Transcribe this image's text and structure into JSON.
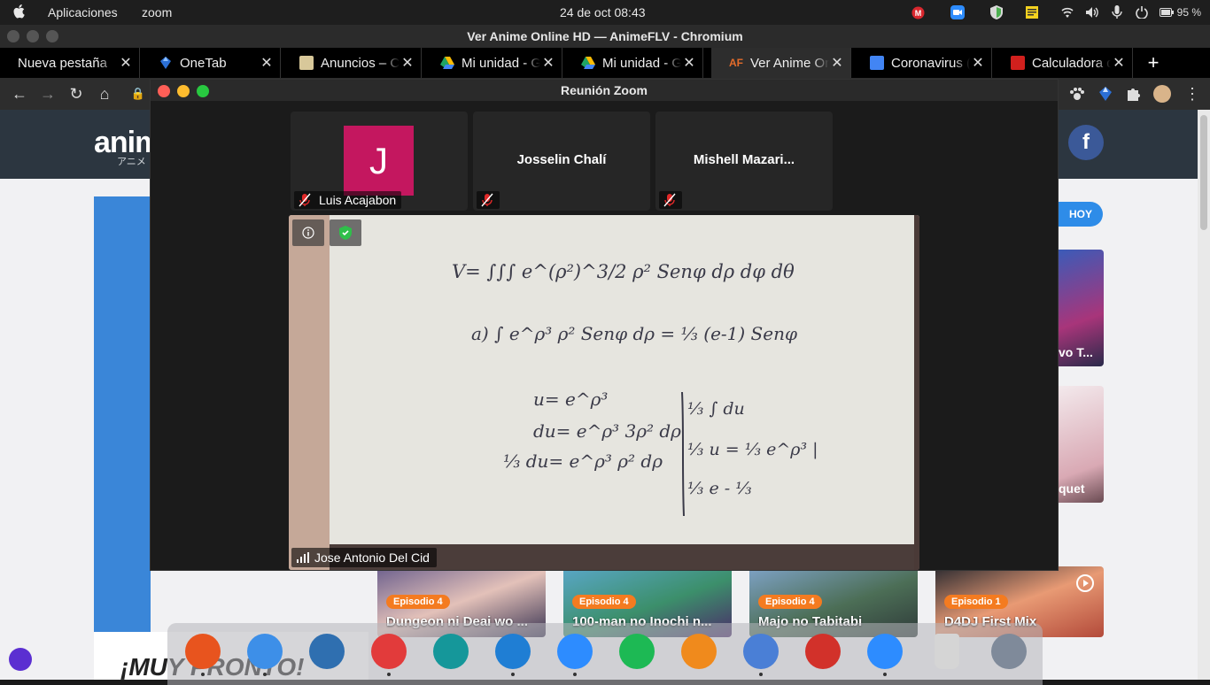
{
  "system_bar": {
    "menu_apps": "Aplicaciones",
    "menu_zoom": "zoom",
    "clock": "24 de oct  08:43",
    "battery": "95 %"
  },
  "browser": {
    "window_title": "Ver Anime Online HD — AnimeFLV - Chromium",
    "tabs": [
      {
        "label": "Nueva pestaña",
        "favicon_color": "",
        "active": false
      },
      {
        "label": "OneTab",
        "favicon_color": "#2b6fd6",
        "active": false
      },
      {
        "label": "Anuncios – CÁ",
        "favicon_color": "#d8c89a",
        "active": false
      },
      {
        "label": "Mi unidad - Go",
        "favicon_color": "#1fa463",
        "active": false
      },
      {
        "label": "Mi unidad - Go",
        "favicon_color": "#1fa463",
        "active": false
      },
      {
        "label": "Ver Anime Onl",
        "favicon_color": "#e46c2b",
        "active": true
      },
      {
        "label": "Coronavirus (C",
        "favicon_color": "#4285f4",
        "active": false
      },
      {
        "label": "Calculadora de",
        "favicon_color": "#d1201d",
        "active": false
      }
    ],
    "new_tab": "+"
  },
  "site": {
    "logo": "anim",
    "logo_sub": "アニメ",
    "facebook": "f",
    "hoy": "HOY",
    "side_cards": [
      {
        "caption": "vo T..."
      },
      {
        "caption": "quet"
      }
    ],
    "episodes": [
      {
        "badge": "Episodio 4",
        "title": "Dungeon ni Deai wo ..."
      },
      {
        "badge": "Episodio 4",
        "title": "100-man no Inochi n..."
      },
      {
        "badge": "Episodio 4",
        "title": "Majo no Tabitabi"
      },
      {
        "badge": "Episodio 1",
        "title": "D4DJ First Mix"
      }
    ],
    "muy_pronto": "¡MUY PRONTO!"
  },
  "zoom": {
    "title": "Reunión Zoom",
    "participants": [
      {
        "name_tile": "",
        "avatar_letter": "J",
        "label": "Luis Acajabon"
      },
      {
        "name_tile": "Josselin Chalí",
        "avatar_letter": "",
        "label": ""
      },
      {
        "name_tile": "Mishell Mazari...",
        "avatar_letter": "",
        "label": ""
      }
    ],
    "speaker": "Jose Antonio Del Cid",
    "info_icon": "i"
  },
  "board_text": [
    "V= ∫∫∫ e^(ρ²)^3/2 ρ² Senφ dρ dφ dθ",
    "a) ∫ e^ρ³ ρ² Senφ dρ = ⅓ (e-1) Senφ",
    "u= e^ρ³",
    "du= e^ρ³ 3ρ² dρ",
    "⅓ du= e^ρ³ ρ² dρ",
    "⅓ ∫ du",
    "⅓ u = ⅓ e^ρ³ |",
    "⅓ e - ⅓"
  ],
  "dock": {
    "apps": [
      {
        "name": "firefox-icon",
        "color": "#e8541e"
      },
      {
        "name": "finder-icon",
        "color": "#3d8fe8"
      },
      {
        "name": "document-viewer-icon",
        "color": "#2f6fb0"
      },
      {
        "name": "eye-icon",
        "color": "#e23b3b"
      },
      {
        "name": "arduino-icon",
        "color": "#15979a"
      },
      {
        "name": "vscode-icon",
        "color": "#1f7ed4"
      },
      {
        "name": "zoom-app-icon",
        "color": "#2d8cff"
      },
      {
        "name": "spotify-icon",
        "color": "#1db954"
      },
      {
        "name": "vlc-icon",
        "color": "#f08a1c"
      },
      {
        "name": "chromium-icon",
        "color": "#4a7fd6"
      },
      {
        "name": "pdf-reader-icon",
        "color": "#d2312a"
      },
      {
        "name": "zoom-meetings-icon",
        "color": "#2d8cff"
      },
      {
        "name": "trash-icon",
        "color": "#d5d5d5"
      },
      {
        "name": "launchpad-icon",
        "color": "#7f8a9a"
      }
    ]
  }
}
